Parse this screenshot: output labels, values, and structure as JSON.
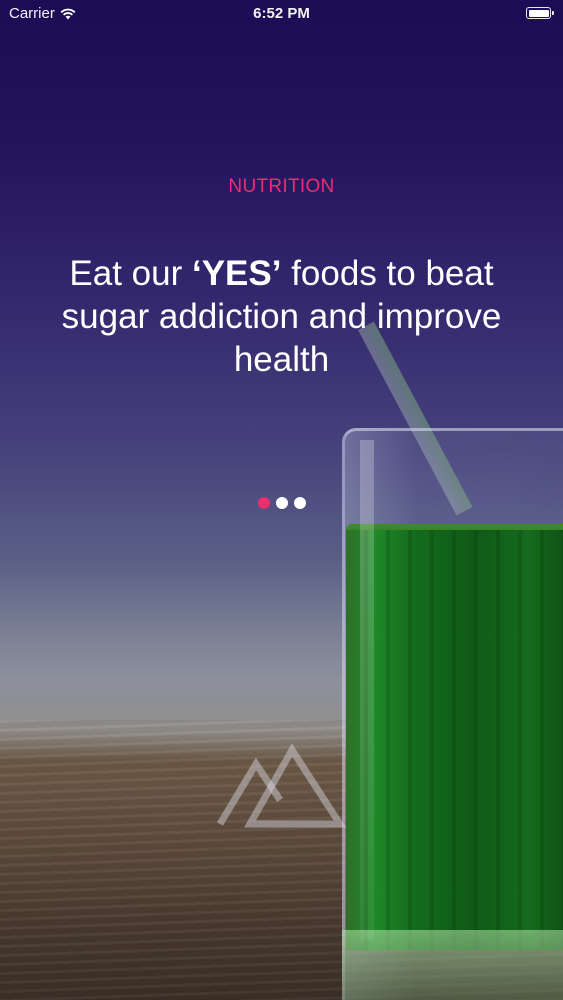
{
  "status_bar": {
    "carrier": "Carrier",
    "time": "6:52 PM",
    "wifi_icon": "wifi-icon",
    "battery_icon": "battery-icon",
    "battery_level": 1.0
  },
  "onboarding": {
    "category": "NUTRITION",
    "headline": {
      "part1": "Eat our ",
      "emphasis": "‘YES’",
      "part2": " foods to beat sugar addiction and improve health"
    },
    "pager": {
      "total": 3,
      "active_index": 0
    },
    "logo_icon": "mountain-logo-icon"
  },
  "colors": {
    "accent": "#ea2e6f",
    "text": "#ffffff",
    "background_top": "#1b0c55"
  }
}
